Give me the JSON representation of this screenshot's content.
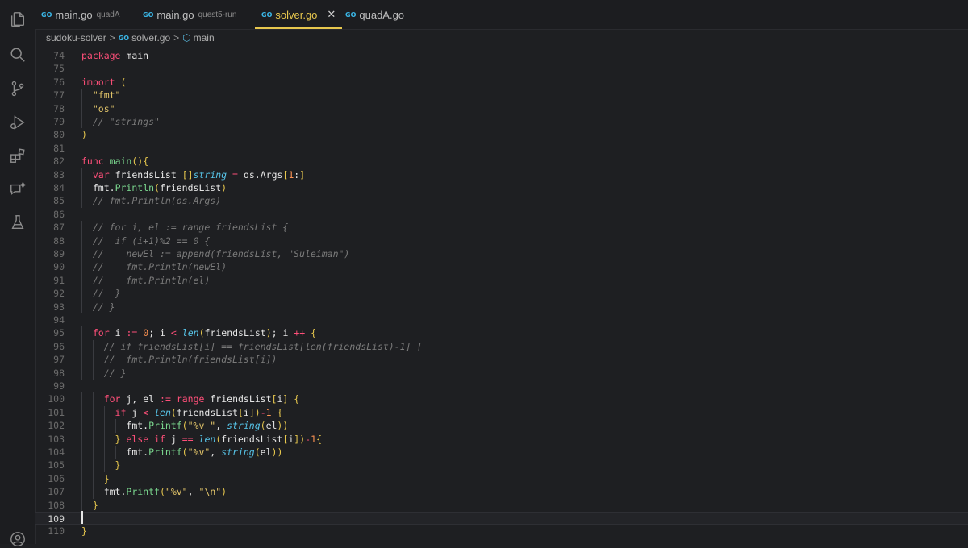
{
  "activity_bar": {
    "icons": [
      "files-icon",
      "search-icon",
      "source-control-icon",
      "run-debug-icon",
      "extensions-icon",
      "remote-chat-icon",
      "testing-icon",
      "account-icon"
    ]
  },
  "tabs": [
    {
      "badge": "GO",
      "label": "main.go",
      "sub": "quadA",
      "active": false
    },
    {
      "badge": "GO",
      "label": "main.go",
      "sub": "quest5-run",
      "active": false
    },
    {
      "badge": "GO",
      "label": "solver.go",
      "sub": "",
      "active": true,
      "close": "✕"
    },
    {
      "badge": "GO",
      "label": "quadA.go",
      "sub": "",
      "active": false
    }
  ],
  "breadcrumb": {
    "folder": "sudoku-solver",
    "separator": ">",
    "file_badge": "GO",
    "file": "solver.go",
    "symbol": "main"
  },
  "colors": {
    "keyword": "#ff4f79",
    "type": "#57c4e8",
    "function": "#7bd88f",
    "string": "#e5c76b",
    "number": "#fd9353",
    "comment": "#7a7a7a",
    "active_tab": "#e8c84e"
  },
  "editor": {
    "current_line": 109,
    "lines": [
      {
        "n": "74",
        "code": "package main"
      },
      {
        "n": "75",
        "code": ""
      },
      {
        "n": "76",
        "code": "import ("
      },
      {
        "n": "77",
        "code": "  \"fmt\""
      },
      {
        "n": "78",
        "code": "  \"os\""
      },
      {
        "n": "79",
        "code": "  // \"strings\""
      },
      {
        "n": "80",
        "code": ")"
      },
      {
        "n": "81",
        "code": ""
      },
      {
        "n": "82",
        "code": "func main(){"
      },
      {
        "n": "83",
        "code": "  var friendsList []string = os.Args[1:]"
      },
      {
        "n": "84",
        "code": "  fmt.Println(friendsList)"
      },
      {
        "n": "85",
        "code": "  // fmt.Println(os.Args)"
      },
      {
        "n": "86",
        "code": ""
      },
      {
        "n": "87",
        "code": "  // for i, el := range friendsList {"
      },
      {
        "n": "88",
        "code": "  //  if (i+1)%2 == 0 {"
      },
      {
        "n": "89",
        "code": "  //    newEl := append(friendsList, \"Suleiman\")"
      },
      {
        "n": "90",
        "code": "  //    fmt.Println(newEl)"
      },
      {
        "n": "91",
        "code": "  //    fmt.Println(el)"
      },
      {
        "n": "92",
        "code": "  //  }"
      },
      {
        "n": "93",
        "code": "  // }"
      },
      {
        "n": "94",
        "code": ""
      },
      {
        "n": "95",
        "code": "  for i := 0; i < len(friendsList); i ++ {"
      },
      {
        "n": "96",
        "code": "    // if friendsList[i] == friendsList[len(friendsList)-1] {"
      },
      {
        "n": "97",
        "code": "    //  fmt.Println(friendsList[i])"
      },
      {
        "n": "98",
        "code": "    // }"
      },
      {
        "n": "99",
        "code": ""
      },
      {
        "n": "100",
        "code": "    for j, el := range friendsList[i] {"
      },
      {
        "n": "101",
        "code": "      if j < len(friendsList[i])-1 {"
      },
      {
        "n": "102",
        "code": "        fmt.Printf(\"%v \", string(el))"
      },
      {
        "n": "103",
        "code": "      } else if j == len(friendsList[i])-1{"
      },
      {
        "n": "104",
        "code": "        fmt.Printf(\"%v\", string(el))"
      },
      {
        "n": "105",
        "code": "      }"
      },
      {
        "n": "106",
        "code": "    }"
      },
      {
        "n": "107",
        "code": "    fmt.Printf(\"%v\", \"\\n\")"
      },
      {
        "n": "108",
        "code": "  }"
      },
      {
        "n": "109",
        "code": ""
      },
      {
        "n": "110",
        "code": "}"
      }
    ]
  }
}
